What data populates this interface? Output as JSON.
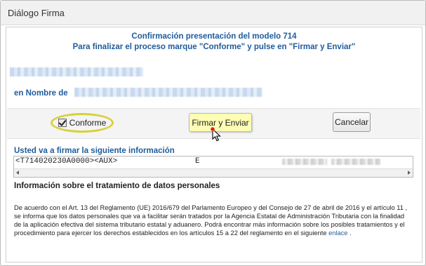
{
  "window": {
    "title": "Diálogo Firma"
  },
  "header": {
    "line1": "Confirmación presentación del modelo 714",
    "line2": "Para finalizar el proceso marque \"Conforme\" y pulse en \"Firmar y Enviar\""
  },
  "taxpayer": {
    "on_behalf_label": "en Nombre de"
  },
  "toolbar": {
    "conforme_label": "Conforme",
    "conforme_checked": true,
    "sign_button_label": "Firmar y Enviar",
    "cancel_button_label": "Cancelar",
    "highlight_color": "#d7d03b",
    "sign_button_color": "#fdfdb4"
  },
  "sign_info": {
    "label": "Usted va a firmar la siguiente información",
    "content": "<T714020230A0000><AUX>",
    "content_extra": "E"
  },
  "privacy": {
    "title": "Información sobre el tratamiento de datos personales",
    "text": "De acuerdo con el Art. 13 del Reglamento (UE) 2016/679 del Parlamento Europeo y del Consejo de 27 de abril de 2016 y el artículo 11 , se informa que los datos personales que va a facilitar serán tratados por la Agencia Estatal de Administración Tributaria con la finalidad de la aplicación efectiva del sistema tributario estatal y aduanero. Podrá encontrar más información sobre los posibles tratamientos y el procedimiento para ejercer los derechos establecidos en los artículos 15 a 22 del reglamento en el siguiente",
    "link_label": "enlace",
    "text_end": "."
  },
  "colors": {
    "accent_blue": "#1f5c9c"
  }
}
